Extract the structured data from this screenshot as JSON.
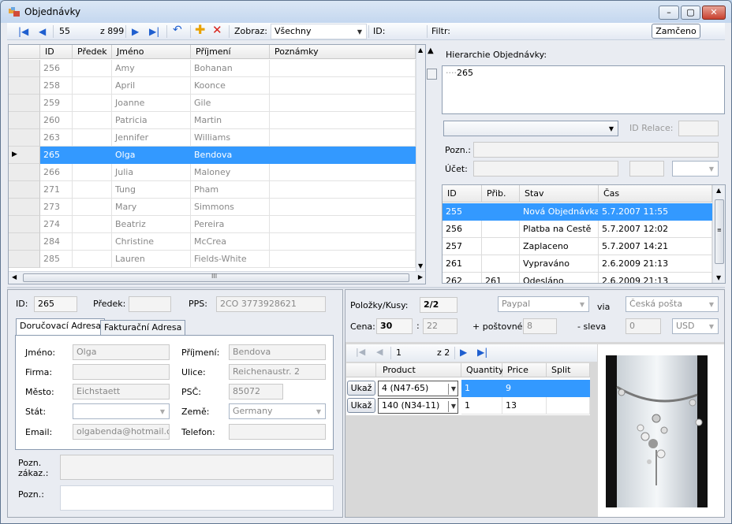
{
  "window": {
    "title": "Objednávky",
    "minimize_icon": "minimize-icon",
    "maximize_icon": "maximize-icon",
    "close_icon": "close-icon"
  },
  "toolbar": {
    "current_record": "55",
    "of_label": "z 899",
    "view_label": "Zobraz:",
    "view_value": "Všechny",
    "id_label": "ID:",
    "filter_label": "Filtr:",
    "lock_button": "Zamčeno"
  },
  "orders_grid": {
    "columns": [
      "ID",
      "Předek",
      "Jméno",
      "Příjmení",
      "Poznámky"
    ],
    "rows": [
      {
        "id": "256",
        "parent": "",
        "first": "Amy",
        "last": "Bohanan",
        "notes": ""
      },
      {
        "id": "258",
        "parent": "",
        "first": "April",
        "last": "Koonce",
        "notes": ""
      },
      {
        "id": "259",
        "parent": "",
        "first": "Joanne",
        "last": "Gile",
        "notes": ""
      },
      {
        "id": "260",
        "parent": "",
        "first": "Patricia",
        "last": "Martin",
        "notes": ""
      },
      {
        "id": "263",
        "parent": "",
        "first": "Jennifer",
        "last": "Williams",
        "notes": ""
      },
      {
        "id": "265",
        "parent": "",
        "first": "Olga",
        "last": "Bendova",
        "notes": ""
      },
      {
        "id": "266",
        "parent": "",
        "first": "Julia",
        "last": "Maloney",
        "notes": ""
      },
      {
        "id": "271",
        "parent": "",
        "first": "Tung",
        "last": "Pham",
        "notes": ""
      },
      {
        "id": "273",
        "parent": "",
        "first": "Mary",
        "last": "Simmons",
        "notes": ""
      },
      {
        "id": "274",
        "parent": "",
        "first": "Beatriz",
        "last": "Pereira",
        "notes": ""
      },
      {
        "id": "284",
        "parent": "",
        "first": "Christine",
        "last": "McCrea",
        "notes": ""
      },
      {
        "id": "285",
        "parent": "",
        "first": "Lauren",
        "last": "Fields-White",
        "notes": ""
      }
    ],
    "selected_index": 5
  },
  "hierarchy": {
    "label": "Hierarchie Objednávky:",
    "node": "265"
  },
  "relation": {
    "id_label": "ID Relace:",
    "note_label": "Pozn.:",
    "account_label": "Účet:"
  },
  "status_grid": {
    "columns": [
      "ID",
      "Přib.",
      "Stav",
      "Čas"
    ],
    "rows": [
      {
        "id": "255",
        "prib": "",
        "stav": "Nová Objednávka",
        "cas": "5.7.2007 11:55"
      },
      {
        "id": "256",
        "prib": "",
        "stav": "Platba na Cestě",
        "cas": "5.7.2007 12:02"
      },
      {
        "id": "257",
        "prib": "",
        "stav": "Zaplaceno",
        "cas": "5.7.2007 14:21"
      },
      {
        "id": "261",
        "prib": "",
        "stav": "Vypraváno",
        "cas": "2.6.2009 21:13"
      },
      {
        "id": "262",
        "prib": "261",
        "stav": "Odesláno",
        "cas": "2.6.2009 21:13"
      }
    ]
  },
  "detail": {
    "id_label": "ID:",
    "id_value": "265",
    "parent_label": "Předek:",
    "parent_value": "",
    "pps_label": "PPS:",
    "pps_value": "2CO 3773928621",
    "tab_delivery": "Doručovací Adresa",
    "tab_billing": "Fakturační Adresa",
    "name_label": "Jméno:",
    "name_value": "Olga",
    "surname_label": "Příjmení:",
    "surname_value": "Bendova",
    "company_label": "Firma:",
    "company_value": "",
    "street_label": "Ulice:",
    "street_value": "Reichenaustr. 2",
    "city_label": "Město:",
    "city_value": "Eichstaett",
    "zip_label": "PSČ:",
    "zip_value": "85072",
    "state_label": "Stát:",
    "state_value": "",
    "country_label": "Země:",
    "country_value": "Germany",
    "email_label": "Email:",
    "email_value": "olgabenda@hotmail.com",
    "phone_label": "Telefon:",
    "phone_value": "",
    "customer_note_label": "Pozn. zákaz.:",
    "note_label": "Pozn.:"
  },
  "summary": {
    "items_label": "Položky/Kusy:",
    "items_value": "2/2",
    "payment_value": "Paypal",
    "via_label": "via",
    "shipping_value": "Česká pošta",
    "price_label": "Cena:",
    "price_value": "30",
    "price_decimal": "22",
    "postage_label": "+ poštovné",
    "postage_value": "8",
    "discount_label": "- sleva",
    "discount_value": "0",
    "currency_value": "USD"
  },
  "items_nav": {
    "current": "1",
    "of_label": "z 2"
  },
  "items_grid": {
    "columns": [
      "Product",
      "Quantity",
      "Price",
      "Split"
    ],
    "show_button": "Ukaž",
    "rows": [
      {
        "product": "4  (N47-65)",
        "quantity": "1",
        "price": "9",
        "split": ""
      },
      {
        "product": "140  (N34-11)",
        "quantity": "1",
        "price": "13",
        "split": ""
      }
    ]
  }
}
